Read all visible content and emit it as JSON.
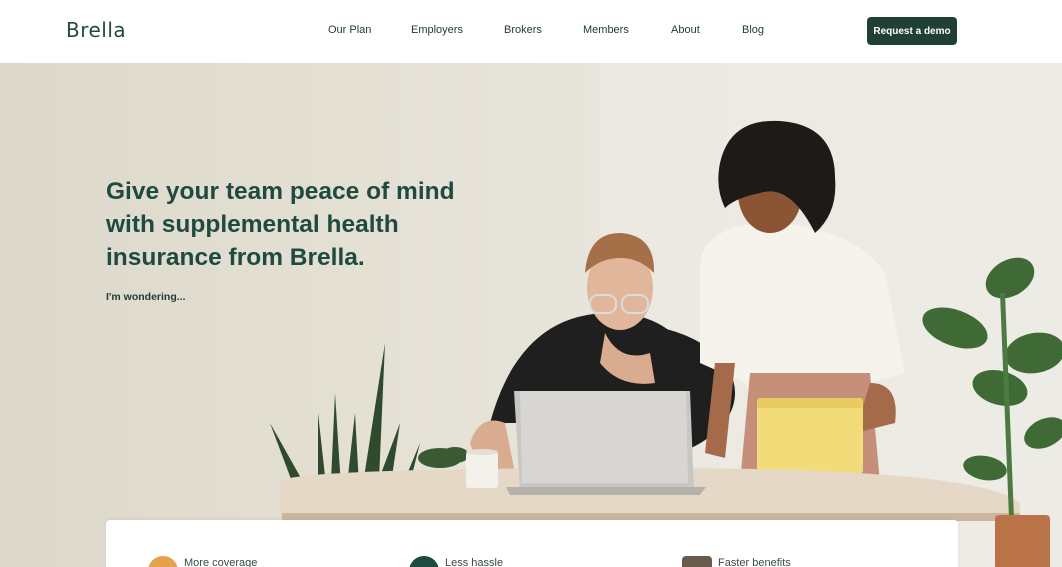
{
  "header": {
    "logo": "Brella",
    "nav": [
      "Our Plan",
      "Employers",
      "Brokers",
      "Members",
      "About",
      "Blog"
    ],
    "cta_label": "Request a demo"
  },
  "hero": {
    "headline": "Give your team peace of mind with supplemental health insurance from Brella.",
    "wondering": "I'm wondering..."
  },
  "benefits": [
    {
      "label": "More coverage",
      "icon": "coverage-icon",
      "color": "#e3a24b"
    },
    {
      "label": "Less hassle",
      "icon": "hassle-icon",
      "color": "#1f4a40"
    },
    {
      "label": "Faster benefits",
      "icon": "faster-benefits-icon",
      "color": "#6a5b4f"
    }
  ],
  "colors": {
    "brand_dark": "#1f3f37",
    "accent_gold": "#e3a24b"
  }
}
